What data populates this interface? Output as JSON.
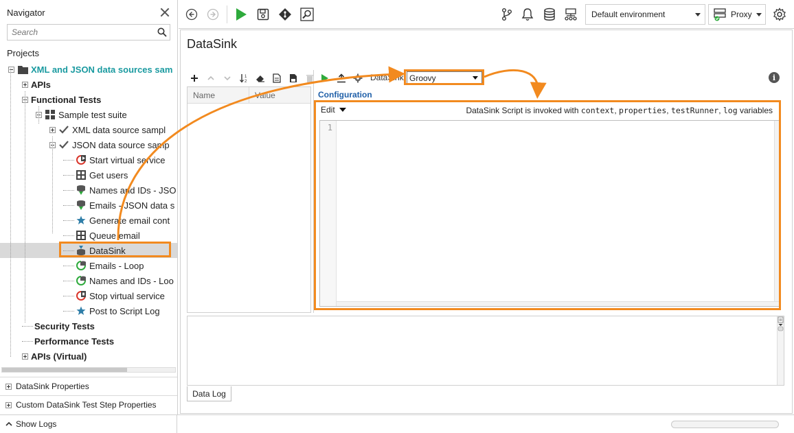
{
  "navigator": {
    "title": "Navigator",
    "search_placeholder": "Search",
    "projects_label": "Projects",
    "tree": [
      {
        "label": "XML and JSON data sources sam",
        "icon": "folder-icon",
        "style": "teal"
      },
      {
        "label": "APIs",
        "icon": "",
        "style": "bold"
      },
      {
        "label": "Functional Tests",
        "icon": "",
        "style": "bold"
      },
      {
        "label": "Sample test suite",
        "icon": "grid-icon",
        "style": ""
      },
      {
        "label": "XML data source sampl",
        "icon": "check-icon",
        "style": ""
      },
      {
        "label": "JSON data source samp",
        "icon": "check-icon",
        "style": ""
      },
      {
        "label": "Start virtual service",
        "icon": "virt-start-icon",
        "style": ""
      },
      {
        "label": "Get users",
        "icon": "request-icon",
        "style": ""
      },
      {
        "label": "Names and IDs - JSO",
        "icon": "datasource-icon",
        "style": ""
      },
      {
        "label": "Emails - JSON data s",
        "icon": "datasource-icon",
        "style": ""
      },
      {
        "label": "Generate email cont",
        "icon": "star-icon",
        "style": ""
      },
      {
        "label": "Queue email",
        "icon": "request-icon",
        "style": ""
      },
      {
        "label": "DataSink",
        "icon": "datasink-icon",
        "style": "selected"
      },
      {
        "label": "Emails - Loop",
        "icon": "loop-icon",
        "style": ""
      },
      {
        "label": "Names and IDs - Loo",
        "icon": "loop-icon",
        "style": ""
      },
      {
        "label": "Stop virtual service",
        "icon": "virt-stop-icon",
        "style": ""
      },
      {
        "label": "Post to Script Log",
        "icon": "star-icon",
        "style": ""
      },
      {
        "label": "Security Tests",
        "icon": "",
        "style": "bold"
      },
      {
        "label": "Performance Tests",
        "icon": "",
        "style": "bold"
      },
      {
        "label": "APIs (Virtual)",
        "icon": "",
        "style": "bold"
      }
    ],
    "sections": [
      "DataSink Properties",
      "Custom DataSink Test Step Properties"
    ]
  },
  "statusbar": {
    "show_logs": "Show Logs"
  },
  "toolbar": {
    "environment": "Default environment",
    "proxy": "Proxy"
  },
  "editor": {
    "title": "DataSink",
    "props_columns": [
      "Name",
      "Value"
    ],
    "datasink_label": "DataSink:",
    "datasink_value": "Groovy",
    "config_label": "Configuration",
    "edit_menu": "Edit",
    "hint_prefix": "DataSink Script is invoked with ",
    "hint_vars": [
      "context",
      "properties",
      "testRunner",
      "log"
    ],
    "hint_suffix": " variables",
    "line_number": "1",
    "log_tab": "Data Log"
  },
  "colors": {
    "highlight": "#f28a1f",
    "teal": "#1a9aa0",
    "config_blue": "#1f5fa8",
    "run_green": "#2eaa3c"
  }
}
